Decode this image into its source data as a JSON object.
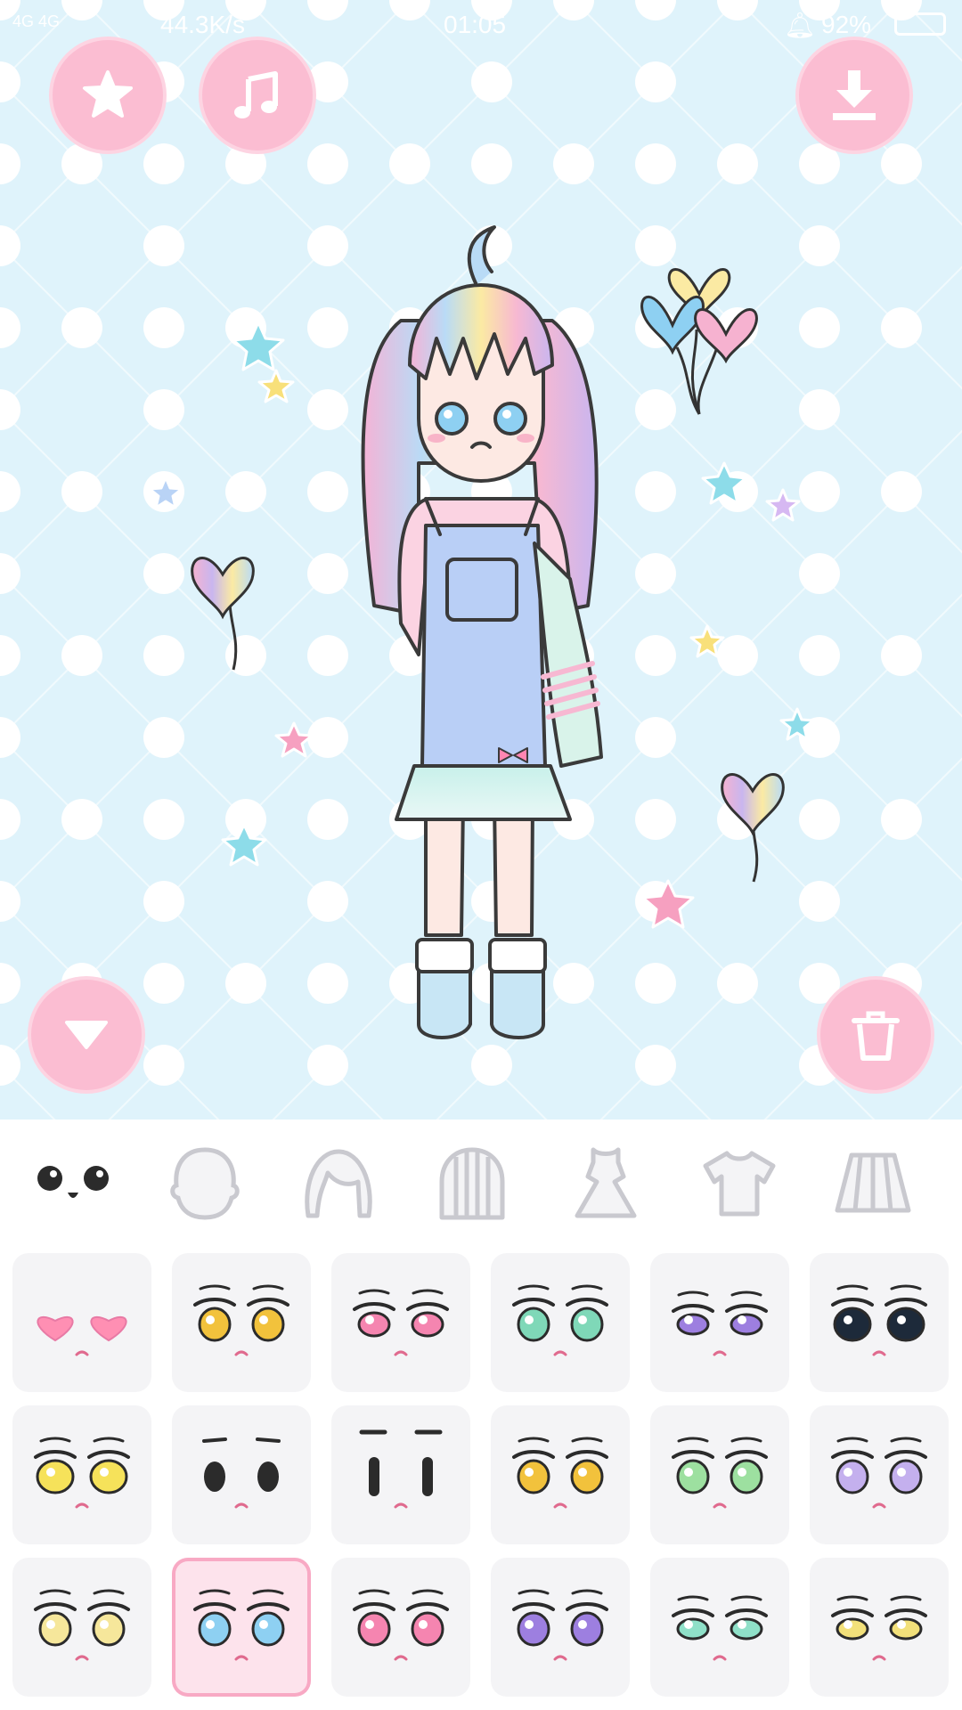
{
  "status_bar": {
    "signal": "4G 4G",
    "network_speed": "44.3K/s",
    "time": "01:05",
    "battery": "92%"
  },
  "toolbar": {
    "favorites_icon": "star-icon",
    "music_icon": "music-note-icon",
    "download_icon": "download-icon",
    "collapse_icon": "triangle-down-icon",
    "delete_icon": "trash-icon"
  },
  "categories": [
    {
      "id": "face",
      "icon": "face-icon",
      "selected": true
    },
    {
      "id": "head",
      "icon": "head-shape-icon",
      "selected": false
    },
    {
      "id": "front-hair",
      "icon": "bangs-icon",
      "selected": false
    },
    {
      "id": "back-hair",
      "icon": "long-hair-icon",
      "selected": false
    },
    {
      "id": "dress",
      "icon": "dress-icon",
      "selected": false
    },
    {
      "id": "top",
      "icon": "tshirt-icon",
      "selected": false
    },
    {
      "id": "skirt",
      "icon": "skirt-icon",
      "selected": false
    }
  ],
  "eye_options": [
    {
      "row": 0,
      "col": 0,
      "eye_color": "#ff8fb3",
      "style": "hearts"
    },
    {
      "row": 0,
      "col": 1,
      "eye_color": "#f2c23c",
      "style": "round"
    },
    {
      "row": 0,
      "col": 2,
      "eye_color": "#f585b0",
      "style": "narrow"
    },
    {
      "row": 0,
      "col": 3,
      "eye_color": "#7fd8b8",
      "style": "round"
    },
    {
      "row": 0,
      "col": 4,
      "eye_color": "#9d7fe0",
      "style": "half-closed"
    },
    {
      "row": 0,
      "col": 5,
      "eye_color": "#1d2a3a",
      "style": "big-dark"
    },
    {
      "row": 1,
      "col": 0,
      "eye_color": "#f6e25a",
      "style": "big-dark"
    },
    {
      "row": 1,
      "col": 1,
      "eye_color": "#2b2b2b",
      "style": "dot"
    },
    {
      "row": 1,
      "col": 2,
      "eye_color": "#2b2b2b",
      "style": "line"
    },
    {
      "row": 1,
      "col": 3,
      "eye_color": "#f2c23c",
      "style": "round"
    },
    {
      "row": 1,
      "col": 4,
      "eye_color": "#9de0a0",
      "style": "round"
    },
    {
      "row": 1,
      "col": 5,
      "eye_color": "#c4b0ee",
      "style": "round"
    },
    {
      "row": 2,
      "col": 0,
      "eye_color": "#f6e79b",
      "style": "round"
    },
    {
      "row": 2,
      "col": 1,
      "eye_color": "#8ed0f2",
      "style": "round",
      "selected": true
    },
    {
      "row": 2,
      "col": 2,
      "eye_color": "#f585b0",
      "style": "round"
    },
    {
      "row": 2,
      "col": 3,
      "eye_color": "#9d7fe0",
      "style": "round"
    },
    {
      "row": 2,
      "col": 4,
      "eye_color": "#8fe0c8",
      "style": "half-closed"
    },
    {
      "row": 2,
      "col": 5,
      "eye_color": "#f2e07a",
      "style": "half-closed"
    }
  ],
  "colors": {
    "background": "#dff3fb",
    "pattern_dots": "#ffffff",
    "button_pink": "#fbbdd2",
    "tab_active": "#2b2b2b",
    "tab_inactive": "#c9c9cf"
  }
}
